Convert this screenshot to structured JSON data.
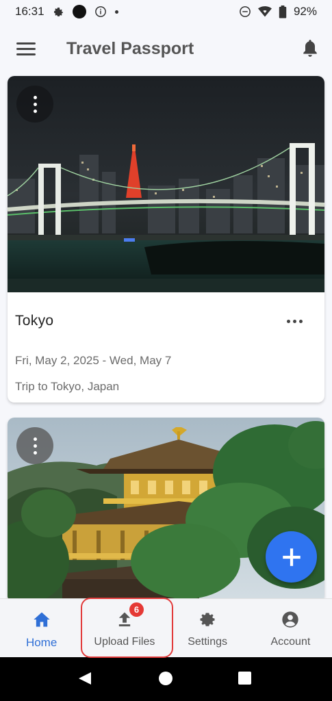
{
  "status_bar": {
    "time": "16:31",
    "battery": "92%"
  },
  "app_bar": {
    "title": "Travel Passport",
    "menu_icon": "hamburger-menu-icon",
    "notification_icon": "bell-icon"
  },
  "trips": [
    {
      "title": "Tokyo",
      "dates": "Fri, May 2, 2025 - Wed, May 7",
      "description": "Trip to Tokyo, Japan",
      "image": "Tokyo night skyline with Rainbow Bridge and Tokyo Tower"
    },
    {
      "image": "Golden pavilion temple (Kinkaku-ji) surrounded by pine trees"
    }
  ],
  "fab": {
    "icon": "plus-icon"
  },
  "bottom_nav": {
    "items": [
      {
        "label": "Home",
        "icon": "home-icon",
        "active": true
      },
      {
        "label": "Upload Files",
        "icon": "upload-icon",
        "badge": "6"
      },
      {
        "label": "Settings",
        "icon": "gear-icon"
      },
      {
        "label": "Account",
        "icon": "account-circle-icon"
      }
    ]
  },
  "colors": {
    "accent": "#2f74f0",
    "active_nav": "#2f6fd6",
    "badge": "#e53935",
    "highlight": "#e23b3b"
  }
}
